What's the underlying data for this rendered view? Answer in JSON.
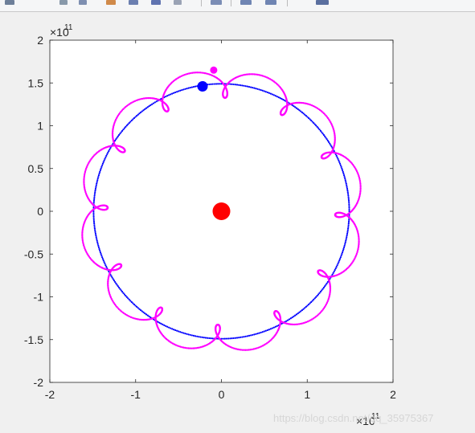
{
  "chart_data": {
    "type": "scatter",
    "title": "",
    "xlabel": "",
    "ylabel": "",
    "xlim": [
      -2,
      2
    ],
    "ylim": [
      -2,
      2
    ],
    "axis_multiplier": "×10",
    "axis_exponent": "11",
    "xticks": [
      "-2",
      "-1",
      "0",
      "1",
      "2"
    ],
    "yticks": [
      "2",
      "1.5",
      "1",
      "0.5",
      "0",
      "-0.5",
      "-1",
      "-1.5",
      "-2"
    ],
    "sun": {
      "x": 0,
      "y": 0,
      "color": "#ff0000"
    },
    "earth_orbit": {
      "center": [
        0,
        0
      ],
      "radius": 1.49,
      "color": "#0000ff",
      "style": "dotted"
    },
    "earth": {
      "x": -0.22,
      "y": 1.46,
      "color": "#0000ff"
    },
    "moon_path": {
      "loops": 13,
      "radius": 0.164,
      "color": "#ff00ff",
      "style": "dotted"
    },
    "moon": {
      "x": -0.09,
      "y": 1.65,
      "color": "#ff00ff"
    }
  },
  "watermark": "https://blog.csdn.net/qq_35975367"
}
